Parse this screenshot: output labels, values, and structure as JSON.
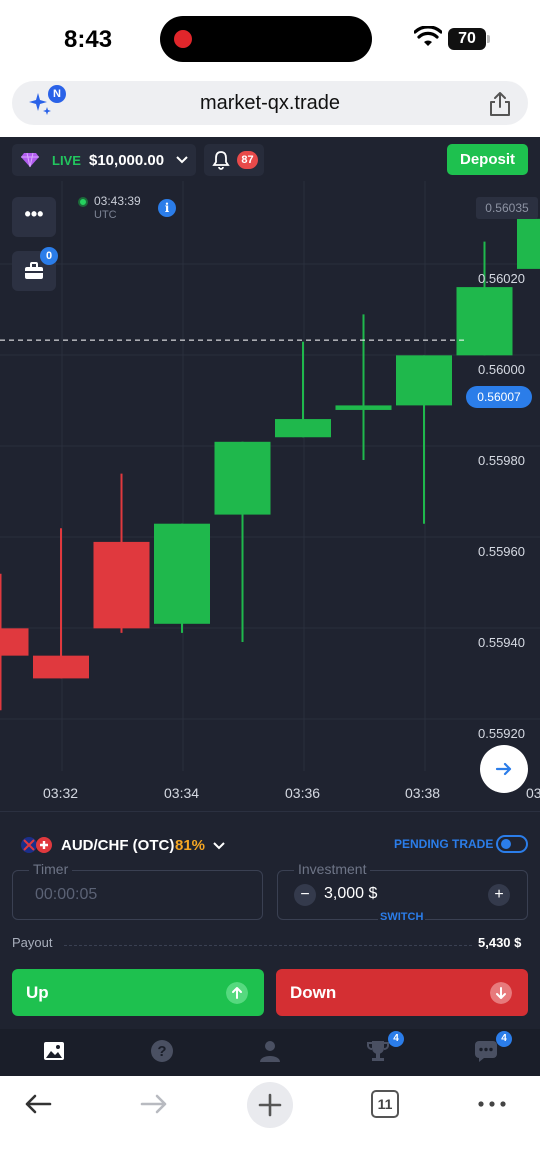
{
  "status_bar": {
    "time": "8:43",
    "battery": "70"
  },
  "browser": {
    "url": "market-qx.trade",
    "extension_badge": "N",
    "tabs_count": "11"
  },
  "topbar": {
    "account_mode": "LIVE",
    "balance": "$10,000.00",
    "notifications": "87",
    "deposit_label": "Deposit"
  },
  "chart": {
    "server_time": "03:43:39",
    "timezone": "UTC",
    "briefcase_badge": "0",
    "top_price_tag": "0.56035",
    "current_price": "0.56007",
    "price_labels": [
      "0.56020",
      "0.56000",
      "0.55980",
      "0.55960",
      "0.55940",
      "0.55920"
    ],
    "time_labels": [
      "03:32",
      "03:34",
      "03:36",
      "03:38",
      "03"
    ]
  },
  "chart_data": {
    "type": "candlestick",
    "ylim": [
      0.55915,
      0.56035
    ],
    "current_price": 0.56007,
    "price_ticks": [
      0.5602,
      0.56,
      0.5598,
      0.5596,
      0.5594,
      0.5592
    ],
    "time_ticks": [
      "03:32",
      "03:34",
      "03:36",
      "03:38"
    ],
    "colors": {
      "up": "#1fb84c",
      "down": "#e0393e"
    },
    "candles": [
      {
        "slot": 0,
        "open": 0.55943,
        "close": 0.55937,
        "high": 0.55955,
        "low": 0.55925
      },
      {
        "slot": 1,
        "open": 0.55937,
        "close": 0.55932,
        "high": 0.55965,
        "low": 0.55932
      },
      {
        "slot": 2,
        "open": 0.55962,
        "close": 0.55943,
        "high": 0.55977,
        "low": 0.55942
      },
      {
        "slot": 3,
        "open": 0.55944,
        "close": 0.55966,
        "high": 0.55966,
        "low": 0.55942
      },
      {
        "slot": 4,
        "open": 0.55968,
        "close": 0.55984,
        "high": 0.55984,
        "low": 0.5594
      },
      {
        "slot": 5,
        "open": 0.55985,
        "close": 0.55989,
        "high": 0.56006,
        "low": 0.55985
      },
      {
        "slot": 6,
        "open": 0.55991,
        "close": 0.55992,
        "high": 0.56012,
        "low": 0.5598
      },
      {
        "slot": 7,
        "open": 0.55992,
        "close": 0.56003,
        "high": 0.56003,
        "low": 0.55966
      },
      {
        "slot": 8,
        "open": 0.56003,
        "close": 0.56018,
        "high": 0.56028,
        "low": 0.56003
      },
      {
        "slot": 9,
        "open": 0.56022,
        "close": 0.56033,
        "high": 0.56033,
        "low": 0.56022
      }
    ]
  },
  "trade_panel": {
    "asset": "AUD/CHF (OTC)",
    "payout_pct": "81%",
    "pending_label": "PENDING TRADE",
    "timer_label": "Timer",
    "timer_value": "00:00:05",
    "investment_label": "Investment",
    "investment_value": "3,000 $",
    "switch_label": "SWITCH",
    "payout_label": "Payout",
    "payout_value": "5,430 $",
    "up_label": "Up",
    "down_label": "Down"
  },
  "app_nav": {
    "trophy_badge": "4",
    "chat_badge": "4"
  }
}
